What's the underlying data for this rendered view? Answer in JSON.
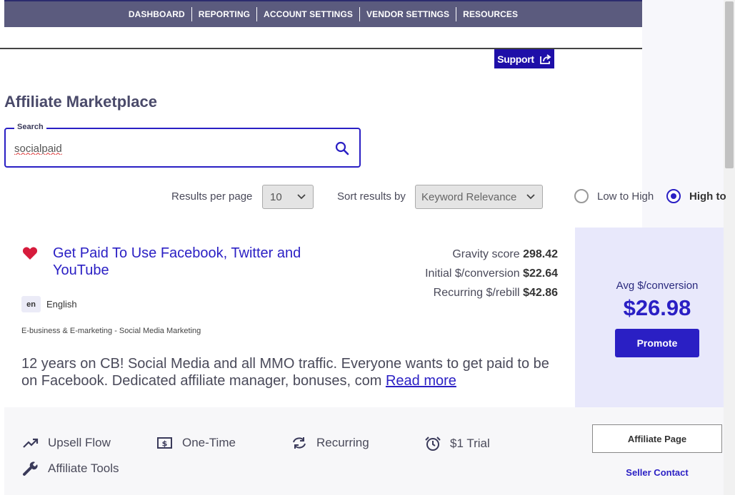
{
  "nav": {
    "items": [
      "DASHBOARD",
      "REPORTING",
      "ACCOUNT SETTINGS",
      "VENDOR SETTINGS",
      "RESOURCES"
    ],
    "background": "#5b5b7e"
  },
  "support": {
    "label": "Support",
    "icon": "external-share-icon"
  },
  "page": {
    "title": "Affiliate Marketplace"
  },
  "search": {
    "label": "Search",
    "value": "socialpaid",
    "icon": "search-icon"
  },
  "controls": {
    "results_per_page_label": "Results per page",
    "results_per_page_value": "10",
    "sort_label": "Sort results by",
    "sort_value": "Keyword Relevance",
    "order_options": [
      {
        "label": "Low to High",
        "selected": false
      },
      {
        "label": "High to",
        "selected": true
      }
    ]
  },
  "product": {
    "favorite_icon": "heart-icon",
    "title": "Get Paid To Use Facebook, Twitter and YouTube",
    "language_code": "en",
    "language": "English",
    "category": "E-business & E-marketing - Social Media Marketing",
    "description": "12 years on CB! Social Media and all MMO traffic. Everyone wants to get paid to be on Facebook. Dedicated affiliate manager, bonuses, com ",
    "read_more": "Read more",
    "stats": [
      {
        "label": "Gravity score",
        "value": "298.42"
      },
      {
        "label": "Initial $/conversion",
        "value": "$22.64"
      },
      {
        "label": "Recurring $/rebill",
        "value": "$42.86"
      }
    ],
    "avg_label": "Avg $/conversion",
    "avg_value": "$26.98",
    "promote_label": "Promote",
    "features": [
      {
        "label": "Upsell Flow",
        "icon": "trending-up-icon"
      },
      {
        "label": "One-Time",
        "icon": "dollar-bill-icon"
      },
      {
        "label": "Recurring",
        "icon": "refresh-icon"
      },
      {
        "label": "$1 Trial",
        "icon": "alarm-clock-icon"
      },
      {
        "label": "Affiliate Tools",
        "icon": "wrench-icon"
      }
    ],
    "affiliate_page_label": "Affiliate Page",
    "seller_contact_label": "Seller Contact"
  },
  "colors": {
    "accent": "#2a1fc4",
    "side_panel": "#e8e8fb",
    "heart": "#d61b3c"
  }
}
